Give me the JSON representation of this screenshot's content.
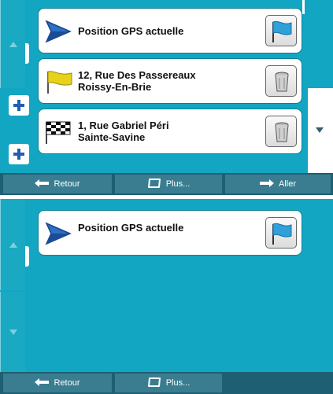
{
  "screens": [
    {
      "items": [
        {
          "line1": "Position GPS actuelle",
          "line2": "",
          "icon": "blue-pennant-icon",
          "action_icon": "blue-flag-icon"
        },
        {
          "line1": "12, Rue Des Passereaux",
          "line2": "Roissy-En-Brie",
          "icon": "yellow-flag-icon",
          "action_icon": "trash-can-icon"
        },
        {
          "line1": "1, Rue Gabriel Péri",
          "line2": "Sainte-Savine",
          "icon": "checkered-flag-icon",
          "action_icon": "trash-can-icon"
        }
      ],
      "bottom_bar": {
        "back_label": "Retour",
        "more_label": "Plus...",
        "go_label": "Aller"
      }
    },
    {
      "items": [
        {
          "line1": "Position GPS actuelle",
          "line2": "",
          "icon": "blue-pennant-icon",
          "action_icon": "blue-flag-icon"
        }
      ],
      "bottom_bar": {
        "back_label": "Retour",
        "more_label": "Plus..."
      }
    }
  ],
  "colors": {
    "background": "#13a6c2",
    "bar": "#1f5f73",
    "button": "#3a7d90",
    "plus": "#1f5fb0"
  }
}
